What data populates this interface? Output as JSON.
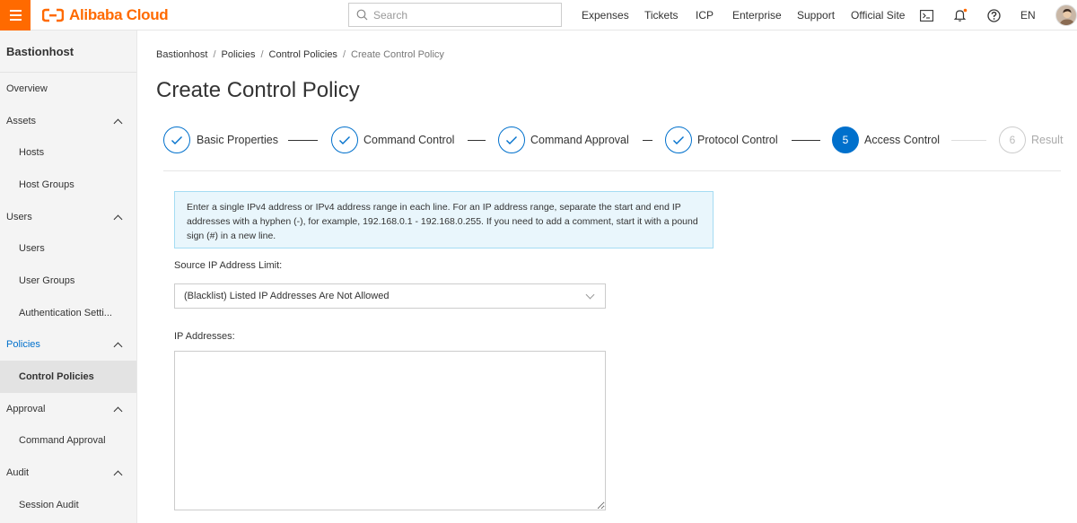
{
  "topbar": {
    "brand": "Alibaba Cloud",
    "brand_color": "#ff6a00",
    "search_placeholder": "Search",
    "nav": [
      "Expenses",
      "Tickets",
      "ICP",
      "Enterprise",
      "Support",
      "Official Site"
    ],
    "language": "EN",
    "icons": [
      "menu-icon",
      "search-icon",
      "terminal-icon",
      "bell-icon",
      "help-icon"
    ]
  },
  "sidebar": {
    "title": "Bastionhost",
    "items": [
      {
        "label": "Overview"
      },
      {
        "label": "Assets"
      },
      {
        "label": "Hosts"
      },
      {
        "label": "Host Groups"
      },
      {
        "label": "Users"
      },
      {
        "label": "Users"
      },
      {
        "label": "User Groups"
      },
      {
        "label": "Authentication Setti..."
      },
      {
        "label": "Policies"
      },
      {
        "label": "Control Policies"
      },
      {
        "label": "Approval"
      },
      {
        "label": "Command Approval"
      },
      {
        "label": "Audit"
      },
      {
        "label": "Session Audit"
      }
    ]
  },
  "breadcrumb": [
    "Bastionhost",
    "Policies",
    "Control Policies",
    "Create Control Policy"
  ],
  "page_title": "Create Control Policy",
  "steps": [
    {
      "label": "Basic Properties",
      "state": "done"
    },
    {
      "label": "Command Control",
      "state": "done"
    },
    {
      "label": "Command Approval",
      "state": "done"
    },
    {
      "label": "Protocol Control",
      "state": "done"
    },
    {
      "label": "Access Control",
      "state": "active",
      "number": "5"
    },
    {
      "label": "Result",
      "state": "pending",
      "number": "6"
    }
  ],
  "notice": "Enter a single IPv4 address or IPv4 address range in each line. For an IP address range, separate the start and end IP addresses with a hyphen (-), for example, 192.168.0.1 - 192.168.0.255. If you need to add a comment, start it with a pound sign (#) in a new line.",
  "form": {
    "source_ip_label": "Source IP Address Limit:",
    "source_ip_value": "(Blacklist) Listed IP Addresses Are Not Allowed",
    "ip_addresses_label": "IP Addresses:",
    "ip_addresses_value": ""
  },
  "colors": {
    "primary": "#0070cc",
    "notice_bg": "#e9f6fc",
    "notice_border": "#a5dcf3"
  }
}
